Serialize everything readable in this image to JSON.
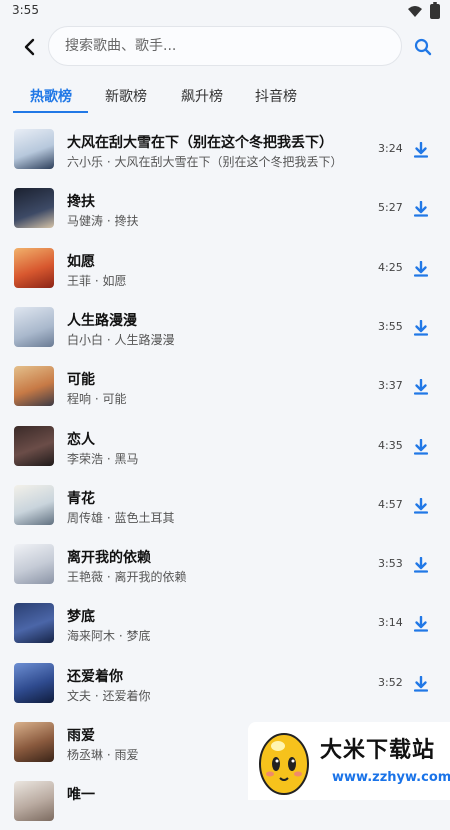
{
  "status": {
    "time": "3:55"
  },
  "search": {
    "placeholder": "搜索歌曲、歌手..."
  },
  "tabs": [
    {
      "label": "热歌榜",
      "active": true
    },
    {
      "label": "新歌榜",
      "active": false
    },
    {
      "label": "飙升榜",
      "active": false
    },
    {
      "label": "抖音榜",
      "active": false
    }
  ],
  "songs": [
    {
      "title": "大风在刮大雪在下（别在这个冬把我丢下）",
      "subtitle": "六小乐 · 大风在刮大雪在下（别在这个冬把我丢下）",
      "duration": "3:24"
    },
    {
      "title": "搀扶",
      "subtitle": "马健涛 · 搀扶",
      "duration": "5:27"
    },
    {
      "title": "如愿",
      "subtitle": "王菲 · 如愿",
      "duration": "4:25"
    },
    {
      "title": "人生路漫漫",
      "subtitle": "白小白 · 人生路漫漫",
      "duration": "3:55"
    },
    {
      "title": "可能",
      "subtitle": "程响 · 可能",
      "duration": "3:37"
    },
    {
      "title": "恋人",
      "subtitle": "李荣浩 · 黑马",
      "duration": "4:35"
    },
    {
      "title": "青花",
      "subtitle": "周传雄 · 蓝色土耳其",
      "duration": "4:57"
    },
    {
      "title": "离开我的依赖",
      "subtitle": "王艳薇 · 离开我的依赖",
      "duration": "3:53"
    },
    {
      "title": "梦底",
      "subtitle": "海来阿木 · 梦底",
      "duration": "3:14"
    },
    {
      "title": "还爱着你",
      "subtitle": "文夫 · 还爱着你",
      "duration": "3:52"
    },
    {
      "title": "雨爱",
      "subtitle": "杨丞琳 · 雨爱",
      "duration": ""
    },
    {
      "title": "唯一",
      "subtitle": "",
      "duration": ""
    }
  ],
  "ad": {
    "title": "大米下载站",
    "url": "www.zzhyw.com"
  },
  "colors": {
    "accent": "#2178e6"
  }
}
